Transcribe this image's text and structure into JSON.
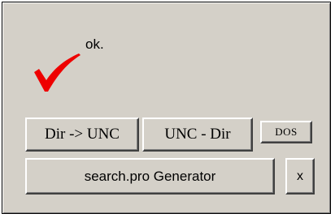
{
  "dialog": {
    "status_text": "ok.",
    "status_icon": "red-checkmark-icon",
    "colors": {
      "background": "#d4d0c8",
      "checkmark": "#ee0000"
    }
  },
  "buttons": {
    "dir_to_unc": "Dir -> UNC",
    "unc_to_dir": "UNC - Dir",
    "dos": "DOS",
    "generator": "search.pro Generator",
    "close": "x"
  }
}
